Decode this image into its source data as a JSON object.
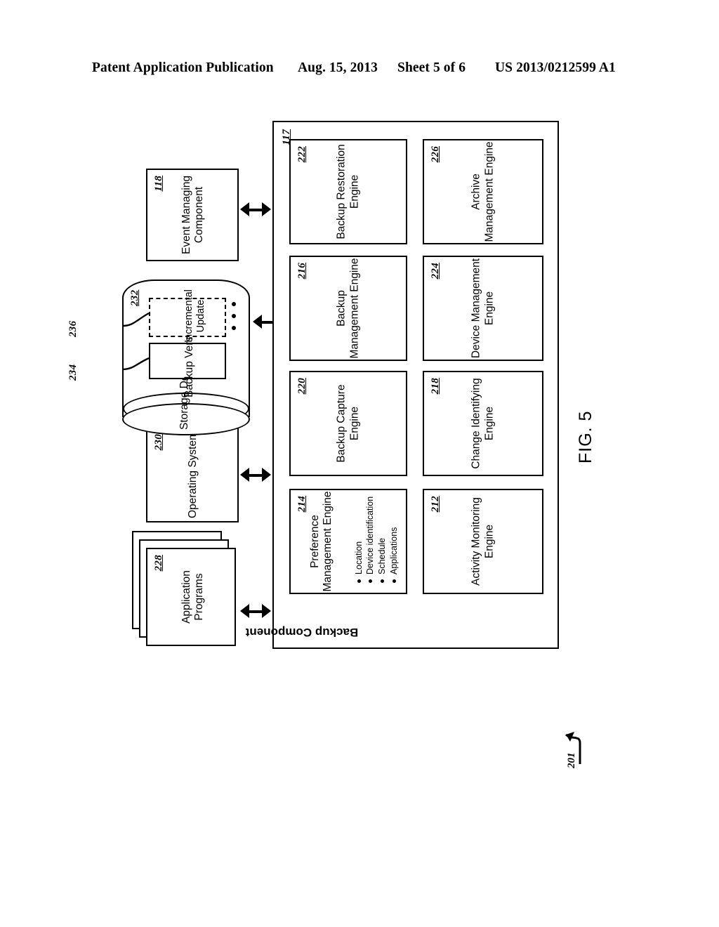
{
  "header": {
    "publication": "Patent Application Publication",
    "date": "Aug. 15, 2013",
    "sheet": "Sheet 5 of 6",
    "patent_number": "US 2013/0212599 A1"
  },
  "figure": {
    "caption": "FIG. 5",
    "system_ref": "201",
    "top_row": [
      {
        "label": "Application Programs",
        "ref": "228",
        "shape": "stacked-documents"
      },
      {
        "label": "Operating System",
        "ref": "230",
        "shape": "rectangle"
      },
      {
        "label": "Storage Device",
        "ref": "",
        "shape": "cylinder"
      },
      {
        "label": "Event Managing Component",
        "ref": "118",
        "shape": "rectangle"
      }
    ],
    "storage": {
      "title": "Storage Device",
      "contents_ref": "232",
      "items": [
        {
          "label": "Backup Version",
          "ref": "234",
          "style": "solid"
        },
        {
          "label": "Incremental Update",
          "ref": "236",
          "style": "dashed"
        }
      ],
      "ellipsis": "•  •  •"
    },
    "backup_component": {
      "title": "Backup Component",
      "ref": "117",
      "engines": [
        {
          "label": "Activity Monitoring Engine",
          "ref": "212"
        },
        {
          "label": "Preference Management Engine",
          "ref": "214",
          "bullets": [
            "Location",
            "Device identification",
            "Schedule",
            "Applications"
          ]
        },
        {
          "label": "Backup Management Engine",
          "ref": "216"
        },
        {
          "label": "Change Identifying Engine",
          "ref": "218"
        },
        {
          "label": "Backup Capture Engine",
          "ref": "220"
        },
        {
          "label": "Backup Restoration Engine",
          "ref": "222"
        },
        {
          "label": "Device Management Engine",
          "ref": "224"
        },
        {
          "label": "Archive Management Engine",
          "ref": "226"
        }
      ]
    },
    "connectors": [
      {
        "from": "Application Programs",
        "to": "Backup Component",
        "type": "double-arrow"
      },
      {
        "from": "Operating System",
        "to": "Backup Component",
        "type": "double-arrow"
      },
      {
        "from": "Storage Device",
        "to": "Backup Component",
        "type": "double-arrow"
      },
      {
        "from": "Event Managing Component",
        "to": "Backup Component",
        "type": "double-arrow"
      }
    ]
  }
}
